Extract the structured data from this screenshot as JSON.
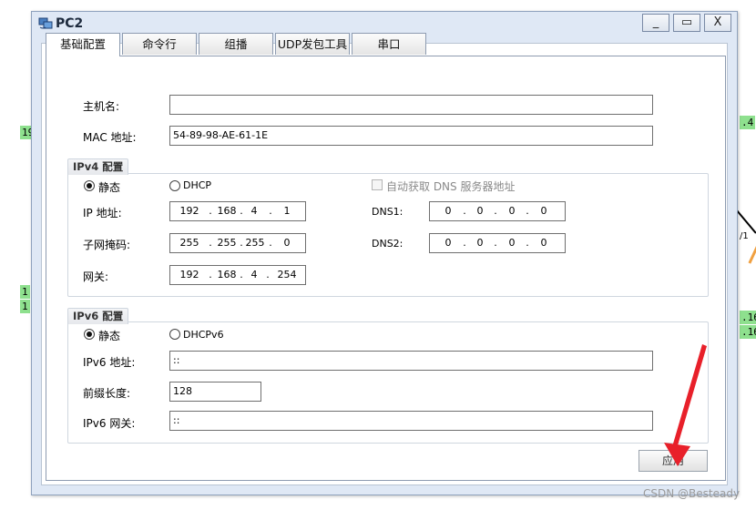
{
  "window": {
    "title": "PC2",
    "min": "_",
    "max": "▭",
    "close": "X"
  },
  "tabs": [
    {
      "label": "基础配置",
      "active": true
    },
    {
      "label": "命令行",
      "active": false
    },
    {
      "label": "组播",
      "active": false
    },
    {
      "label": "UDP发包工具",
      "active": false
    },
    {
      "label": "串口",
      "active": false
    }
  ],
  "basic": {
    "hostname_label": "主机名:",
    "hostname_value": "",
    "mac_label": "MAC 地址:",
    "mac_value": "54-89-98-AE-61-1E"
  },
  "ipv4": {
    "title": "IPv4 配置",
    "static_label": "静态",
    "static_checked": true,
    "dhcp_label": "DHCP",
    "dhcp_checked": false,
    "auto_dns_label": "自动获取 DNS 服务器地址",
    "ip_label": "IP 地址:",
    "ip": [
      "192",
      "168",
      "4",
      "1"
    ],
    "mask_label": "子网掩码:",
    "mask": [
      "255",
      "255",
      "255",
      "0"
    ],
    "gateway_label": "网关:",
    "gateway": [
      "192",
      "168",
      "4",
      "254"
    ],
    "dns1_label": "DNS1:",
    "dns1": [
      "0",
      "0",
      "0",
      "0"
    ],
    "dns2_label": "DNS2:",
    "dns2": [
      "0",
      "0",
      "0",
      "0"
    ],
    "dot": "."
  },
  "ipv6": {
    "title": "IPv6 配置",
    "static_label": "静态",
    "static_checked": true,
    "dhcp_label": "DHCPv6",
    "dhcp_checked": false,
    "addr_label": "IPv6 地址:",
    "addr_value": "::",
    "prefix_label": "前缀长度:",
    "prefix_value": "128",
    "gateway_label": "IPv6 网关:",
    "gateway_value": "::"
  },
  "apply_label": "应用",
  "background": {
    "tags": [
      "19",
      "1",
      "1",
      ".4",
      ".16",
      ".16"
    ],
    "link_label": "/1"
  },
  "watermark": "CSDN @Besteady",
  "colors": {
    "window_border": "#8fa2bd",
    "tag_green": "#8ee08e",
    "arrow_red": "#e8202a"
  }
}
